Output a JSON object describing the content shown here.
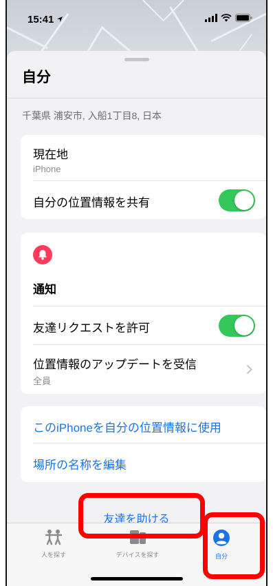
{
  "status_bar": {
    "time": "15:41"
  },
  "sheet": {
    "title": "自分",
    "address": "千葉県 浦安市, 入船1丁目8, 日本"
  },
  "location_card": {
    "current_location_title": "現在地",
    "current_location_sub": "iPhone",
    "share_location_label": "自分の位置情報を共有",
    "share_location_on": true
  },
  "notifications_card": {
    "header": "通知",
    "allow_friend_requests_label": "友達リクエストを許可",
    "allow_friend_requests_on": true,
    "receive_updates_label": "位置情報のアップデートを受信",
    "receive_updates_value": "全員"
  },
  "actions_card": {
    "use_this_iphone": "このiPhoneを自分の位置情報に使用",
    "edit_location_name": "場所の名称を編集"
  },
  "help_friend": "友達を助ける",
  "tabs": [
    {
      "label": "人を探す",
      "icon": "people-icon",
      "selected": false
    },
    {
      "label": "デバイスを探す",
      "icon": "devices-icon",
      "selected": false
    },
    {
      "label": "自分",
      "icon": "person-circle-icon",
      "selected": true
    }
  ],
  "colors": {
    "accent": "#1a73e8",
    "toggle_on": "#34c759",
    "bell_badge": "#ff3b5c",
    "annotation": "#ff0000"
  }
}
